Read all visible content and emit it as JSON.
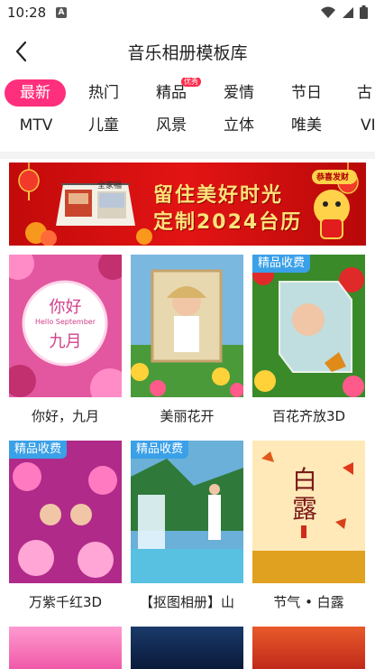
{
  "status_bar": {
    "time": "10:28",
    "notification_letter": "A"
  },
  "header": {
    "title": "音乐相册模板库"
  },
  "tabs_row1": [
    {
      "label": "最新",
      "active": true
    },
    {
      "label": "热门"
    },
    {
      "label": "精品",
      "badge": "优秀"
    },
    {
      "label": "爱情"
    },
    {
      "label": "节日"
    },
    {
      "label": "古"
    }
  ],
  "tabs_row2": [
    {
      "label": "MTV"
    },
    {
      "label": "儿童"
    },
    {
      "label": "风景"
    },
    {
      "label": "立体"
    },
    {
      "label": "唯美"
    },
    {
      "label": "VI"
    }
  ],
  "banner": {
    "line1": "留住美好时光",
    "line2": "定制2024台历",
    "tag": "恭喜发财",
    "calendar_caption": "全家福"
  },
  "templates": [
    {
      "label": "你好，九月",
      "thumb_text_cn": "你好",
      "thumb_text_en": "Hello September",
      "thumb_text_cn2": "九月"
    },
    {
      "label": "美丽花开"
    },
    {
      "label": "百花齐放3D",
      "premium": "精品收费"
    },
    {
      "label": "万紫千红3D",
      "premium": "精品收费"
    },
    {
      "label": "【抠图相册】山",
      "premium": "精品收费"
    },
    {
      "label": "节气 • 白露",
      "thumb_text": "白露"
    }
  ],
  "colors": {
    "accent": "#ff2f7d",
    "premium_badge": "#3aa0e8",
    "banner_red": "#d81010"
  }
}
